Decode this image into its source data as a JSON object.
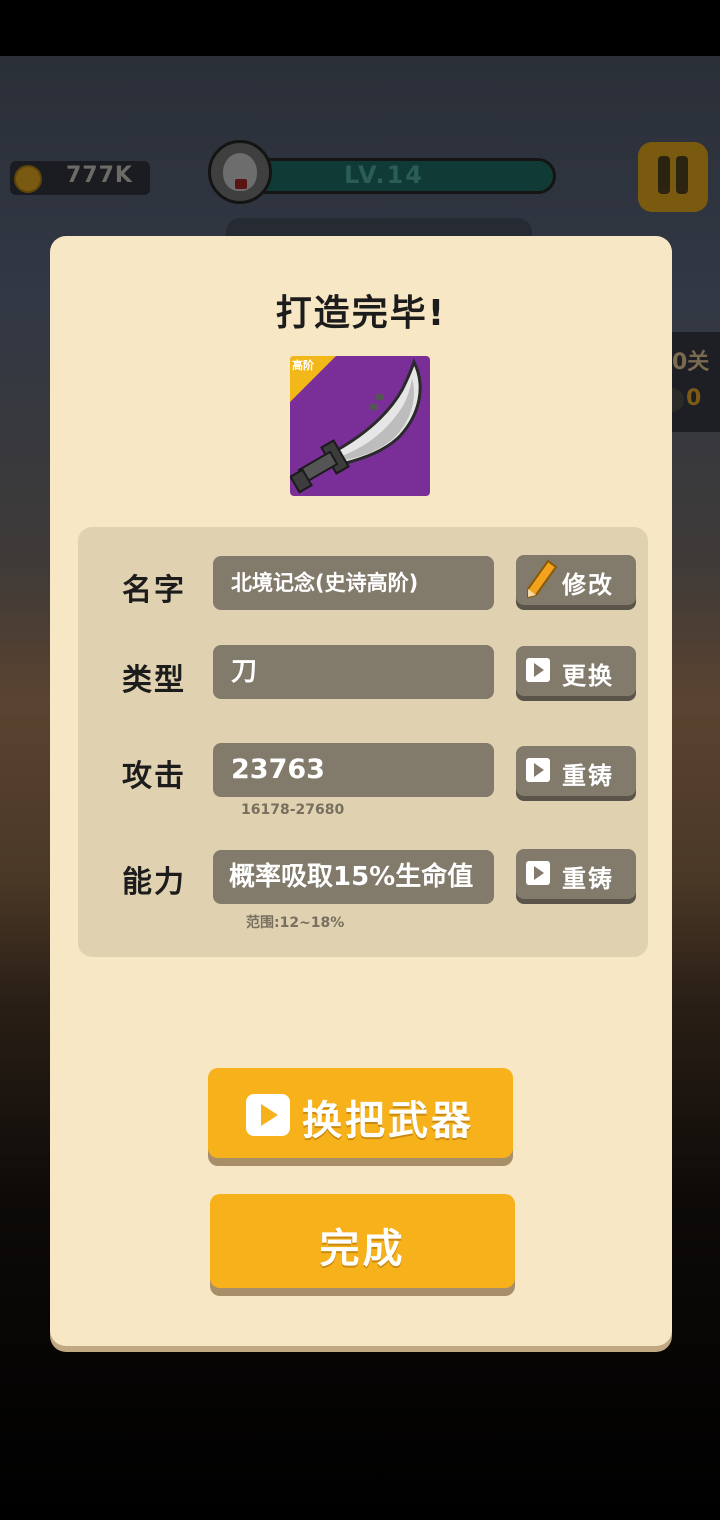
{
  "hud": {
    "coins": "777K",
    "level": "LV.14",
    "side_stage_text": "0关",
    "side_count": "0"
  },
  "modal": {
    "title": "打造完毕!",
    "weapon_badge": "高阶",
    "rows": {
      "name": {
        "label": "名字",
        "value": "北境记念(史诗高阶)",
        "button": "修改"
      },
      "type": {
        "label": "类型",
        "value": "刀",
        "button": "更换"
      },
      "attack": {
        "label": "攻击",
        "value": "23763",
        "button": "重铸",
        "range": "16178-27680"
      },
      "ability": {
        "label": "能力",
        "value": "概率吸取15%生命值",
        "button": "重铸",
        "range": "范围:12~18%"
      }
    },
    "swap_button": "换把武器",
    "done_button": "完成"
  },
  "colors": {
    "modal_bg": "#f7e7c4",
    "stats_bg": "#e0d1b1",
    "field_bg": "#827a6b",
    "accent_orange": "#f7b11b",
    "weapon_card_bg": "#7a2e98"
  },
  "icons": [
    "coin-icon",
    "avatar-icon",
    "pause-icon",
    "pencil-icon",
    "play-icon",
    "weapon-blade-icon"
  ]
}
